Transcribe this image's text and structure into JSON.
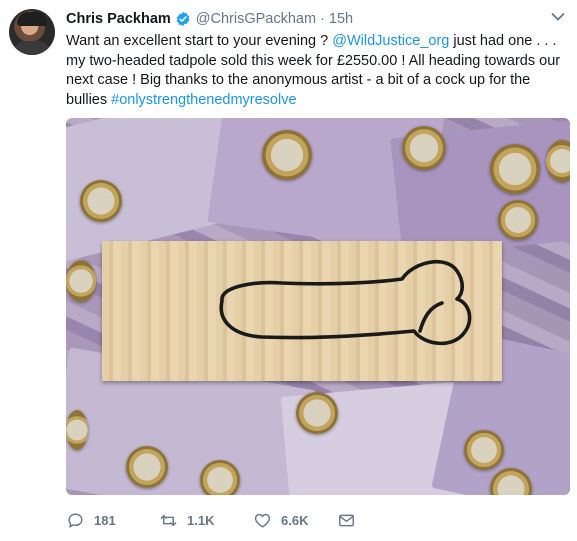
{
  "tweet": {
    "author_name": "Chris Packham",
    "handle": "@ChrisGPackham",
    "separator": "·",
    "time": "15h",
    "text_before": "Want an excellent start to your evening ? ",
    "mention": "@WildJustice_org",
    "text_after": " just had one . . . my two-headed tadpole sold this week for £2550.00 ! All heading towards our next case ! Big thanks to the anonymous artist - a bit of a cock up for the bullies ",
    "hashtag": "#onlystrengthenedmyresolve"
  },
  "actions": {
    "replies": "181",
    "retweets": "1.1K",
    "likes": "6.6K"
  },
  "icons": {
    "verified": "verified-badge-icon",
    "more": "chevron-down-icon",
    "reply": "reply-icon",
    "retweet": "retweet-icon",
    "like": "heart-icon",
    "dm": "envelope-icon"
  },
  "colors": {
    "link": "#1b95e0",
    "secondary_text": "#657786",
    "primary_text": "#14171a",
    "verified": "#1da1f2"
  }
}
